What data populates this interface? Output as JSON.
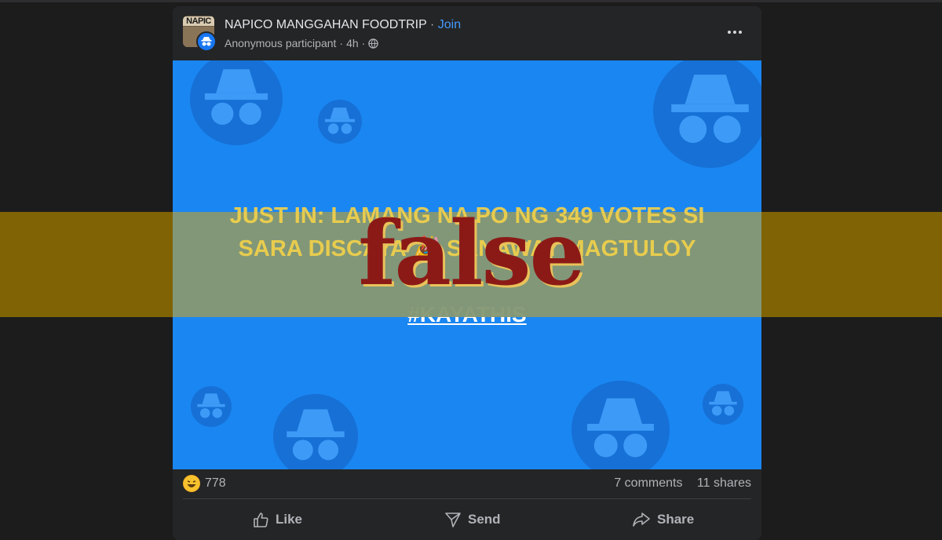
{
  "post": {
    "group_name": "NAPICO MANGGAHAN FOODTRIP",
    "group_logo_text": "NAPIC",
    "separator": "·",
    "join_label": "Join",
    "author": "Anonymous participant",
    "time": "4h",
    "privacy_icon": "globe-icon",
    "more_icon": "more-options-icon",
    "image_text_line1": "JUST IN: LAMANG NA PO NG 349 VOTES SI",
    "image_text_line2": "SARA DISCAYA 🎉 SANAWAY MAGTULOY",
    "hashtag": "#KAYATHIS",
    "image_bg_color": "#1a86f2",
    "text_color": "#ffd84a"
  },
  "stats": {
    "reaction_icon": "laughing-emoji-icon",
    "reaction_count": "778",
    "comments": "7 comments",
    "shares": "11 shares"
  },
  "actions": {
    "like_label": "Like",
    "send_label": "Send",
    "share_label": "Share"
  },
  "overlay": {
    "verdict": "false",
    "band_color": "#967300",
    "verdict_color": "#8b1a17"
  }
}
